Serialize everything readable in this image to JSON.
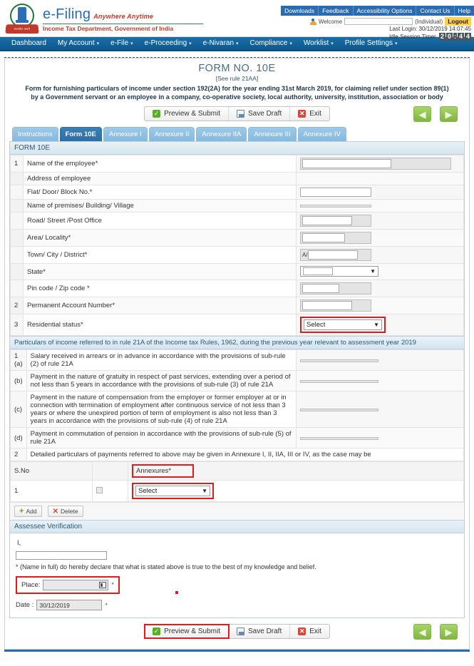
{
  "header": {
    "brand_name": "e-Filing",
    "brand_tagline": "Anywhere Anytime",
    "brand_subtitle": "Income Tax Department, Government of India",
    "emblem_motto": "सत्यमेव जयते",
    "top_links": [
      "Downloads",
      "Feedback",
      "Accessibility Options",
      "Contact Us",
      "Help"
    ],
    "welcome_label": "Welcome",
    "user_name": "",
    "user_type": "(Individual)",
    "logout_label": "Logout",
    "last_login": "Last Login: 30/12/2019 14:07:45",
    "idle_label": "Idle Session Timer",
    "idle_digits": [
      "2",
      "0",
      "4",
      "4"
    ],
    "idle_separator": ":"
  },
  "nav": {
    "items": [
      {
        "label": "Dashboard",
        "caret": false
      },
      {
        "label": "My Account",
        "caret": true
      },
      {
        "label": "e-File",
        "caret": true
      },
      {
        "label": "e-Proceeding",
        "caret": true
      },
      {
        "label": "e-Nivaran",
        "caret": true
      },
      {
        "label": "Compliance",
        "caret": true
      },
      {
        "label": "Worklist",
        "caret": true
      },
      {
        "label": "Profile Settings",
        "caret": true
      }
    ]
  },
  "form_header": {
    "title": "FORM NO. 10E",
    "rule": "[See rule 21AA]",
    "description": "Form for furnishing particulars of income under section 192(2A) for the year ending 31st March 2019, for claiming relief under section 89(1) by a Government servant or an employee in a company, co-operative society, local authority, university, institution, association or body"
  },
  "actions": {
    "preview_submit": "Preview & Submit",
    "save_draft": "Save Draft",
    "exit": "Exit",
    "prev_arrow": "◀",
    "next_arrow": "▶"
  },
  "tabs": [
    {
      "label": "Instructions",
      "active": false
    },
    {
      "label": "Form 10E",
      "active": true
    },
    {
      "label": "Annexure I",
      "active": false
    },
    {
      "label": "Annexure II",
      "active": false
    },
    {
      "label": "Annexure IIA",
      "active": false
    },
    {
      "label": "Annexure III",
      "active": false
    },
    {
      "label": "Annexure IV",
      "active": false
    }
  ],
  "form": {
    "section_title": "FORM 10E",
    "rows": [
      {
        "num": "1",
        "label": "Name of the employee*",
        "value": ""
      },
      {
        "num": "",
        "label": "Address of employee",
        "value": ""
      },
      {
        "num": "",
        "label": "Flat/ Door/ Block No.*",
        "value": ""
      },
      {
        "num": "",
        "label": "Name of premises/ Building/ Village",
        "value": ""
      },
      {
        "num": "",
        "label": "Road/ Street /Post Office",
        "value": ""
      },
      {
        "num": "",
        "label": "Area/ Locality*",
        "value": ""
      },
      {
        "num": "",
        "label": "Town/ City / District*",
        "value": "A/"
      },
      {
        "num": "",
        "label": "State*",
        "value": ""
      },
      {
        "num": "",
        "label": "Pin code / Zip code *",
        "value": ""
      },
      {
        "num": "2",
        "label": "Permanent Account Number*",
        "value": ""
      },
      {
        "num": "3",
        "label": "Residential status*",
        "value": "Select"
      }
    ],
    "particulars_bar": "Particulars of income referred to in rule 21A of the Income tax Rules, 1962, during the previous year relevant to assessment year 2019",
    "particulars": [
      {
        "num": "1 (a)",
        "label": "Salary received in arrears or in advance in accordance with the provisions of sub-rule (2) of rule 21A",
        "value": ""
      },
      {
        "num": "(b)",
        "label": "Payment in the nature of gratuity in respect of past services, extending over a period of not less than 5 years in accordance with the provisions of sub-rule (3) of rule 21A",
        "value": ""
      },
      {
        "num": "(c)",
        "label": "Payment in the nature of compensation from the employer or former employer at or in connection with termination of employment after continuous service of not less than 3 years or where the unexpired portion of term of employment is also not less than 3 years in accordance with the provisions of sub-rule (4) of rule 21A",
        "value": ""
      },
      {
        "num": "(d)",
        "label": "Payment in commutation of pension in accordance with the provisions of sub-rule (5) of rule 21A",
        "value": ""
      }
    ],
    "note_row": {
      "num": "2",
      "label": "Detailed particulars of payments referred to above may be given in Annexure I, II, IIA, III or IV, as the case may be"
    }
  },
  "annexures_table": {
    "col_sno": "S.No",
    "col_annexures": "Annexures*",
    "rows": [
      {
        "sno": "1",
        "selected": "Select"
      }
    ],
    "add_label": "Add",
    "delete_label": "Delete"
  },
  "verification": {
    "header": "Assessee Verification",
    "i_label": "I,",
    "name_value": "",
    "declaration": "* (Name in full) do hereby declare that what is stated above is true to the best of my knowledge and belief.",
    "place_label": "Place:",
    "place_value": "",
    "place_asterisk": "*",
    "date_label": "Date :",
    "date_value": "30/12/2019",
    "date_asterisk": "*"
  }
}
